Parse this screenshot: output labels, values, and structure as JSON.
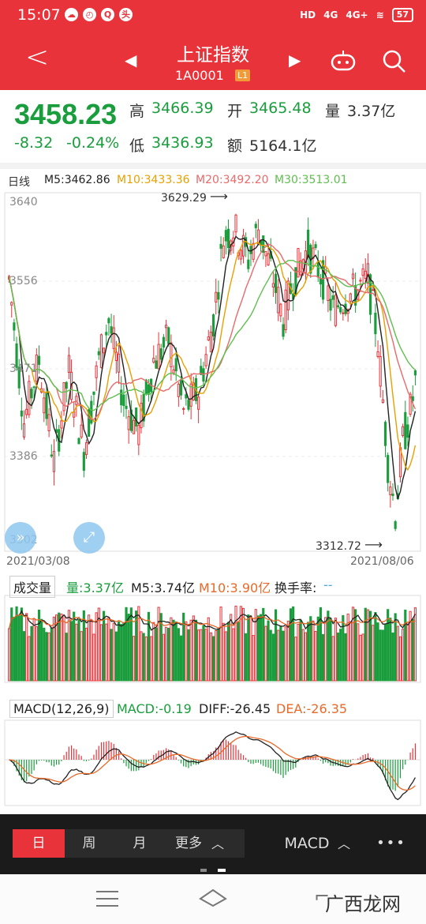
{
  "status": {
    "time": "15:07",
    "icons": [
      "cloud-icon",
      "clock-icon",
      "q-icon",
      "news-icon"
    ],
    "net1": "4G",
    "net2": "4G+",
    "battery": "57"
  },
  "nav": {
    "title": "上证指数",
    "code": "1A0001",
    "badge": "L1"
  },
  "quote": {
    "price": "3458.23",
    "change": "-8.32",
    "pct": "-0.24%",
    "high_label": "高",
    "high": "3466.39",
    "open_label": "开",
    "open": "3465.48",
    "vol_label": "量",
    "vol": "3.37亿",
    "low_label": "低",
    "low": "3436.93",
    "amt_label": "额",
    "amt": "5164.1亿"
  },
  "kline": {
    "period": "日线",
    "ma5": "M5:3462.86",
    "ma10": "M10:3433.36",
    "ma20": "M20:3492.20",
    "ma30": "M30:3513.01",
    "ylabels": [
      "3640",
      "3556",
      "3471",
      "3386",
      "3302"
    ],
    "max_label": "3629.29",
    "min_label": "3312.72",
    "start_date": "2021/03/08",
    "end_date": "2021/08/06"
  },
  "volume": {
    "title": "成交量",
    "vol": "量:3.37亿",
    "m5": "M5:3.74亿",
    "m10": "M10:3.90亿",
    "turnover": "换手率:",
    "turnover_val": "--"
  },
  "macd": {
    "title": "MACD(12,26,9)",
    "macd": "MACD:-0.19",
    "diff": "DIFF:-26.45",
    "dea": "DEA:-26.35"
  },
  "tabs": {
    "day": "日",
    "week": "周",
    "month": "月",
    "more": "更多",
    "indicator": "MACD",
    "more_dots": "•••"
  },
  "watermark": "广西龙网",
  "colors": {
    "red": "#e8333a",
    "green": "#1a9d3c",
    "ma5": "#222222",
    "ma10": "#e8a000",
    "ma20": "#e86a6a",
    "ma30": "#5fbf4f"
  },
  "chart_data": {
    "type": "candlestick",
    "start_date": "2021/03/08",
    "end_date": "2021/08/06",
    "ylim": [
      3302,
      3640
    ],
    "max": 3629.29,
    "min": 3312.72,
    "ma": {
      "M5": 3462.86,
      "M10": 3433.36,
      "M20": 3492.2,
      "M30": 3513.01
    },
    "volume": {
      "vol": 3.37,
      "M5": 3.74,
      "M10": 3.9,
      "unit": "亿"
    },
    "macd": {
      "MACD": -0.19,
      "DIFF": -26.45,
      "DEA": -26.35
    }
  }
}
